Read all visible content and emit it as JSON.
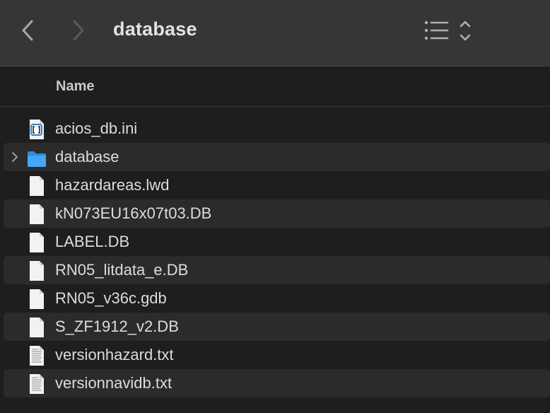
{
  "toolbar": {
    "title": "database",
    "icons": {
      "back": "chevron-left-icon",
      "forward": "chevron-right-icon",
      "view": "list-view-icon"
    }
  },
  "columns": {
    "name": "Name"
  },
  "files": [
    {
      "name": "acios_db.ini",
      "icon": "ini-file-icon"
    },
    {
      "name": "database",
      "icon": "folder-icon",
      "expandable": true
    },
    {
      "name": "hazardareas.lwd",
      "icon": "document-icon"
    },
    {
      "name": "kN073EU16x07t03.DB",
      "icon": "document-icon"
    },
    {
      "name": "LABEL.DB",
      "icon": "document-icon"
    },
    {
      "name": "RN05_litdata_e.DB",
      "icon": "document-icon"
    },
    {
      "name": "RN05_v36c.gdb",
      "icon": "document-icon"
    },
    {
      "name": "S_ZF1912_v2.DB",
      "icon": "document-icon"
    },
    {
      "name": "versionhazard.txt",
      "icon": "text-file-icon"
    },
    {
      "name": "versionnavidb.txt",
      "icon": "text-file-icon"
    }
  ],
  "colors": {
    "toolbar_bg": "#363636",
    "window_bg": "#1e1e1e",
    "alt_row_bg": "#2b2b2b",
    "folder_blue": "#3a9cf0"
  }
}
